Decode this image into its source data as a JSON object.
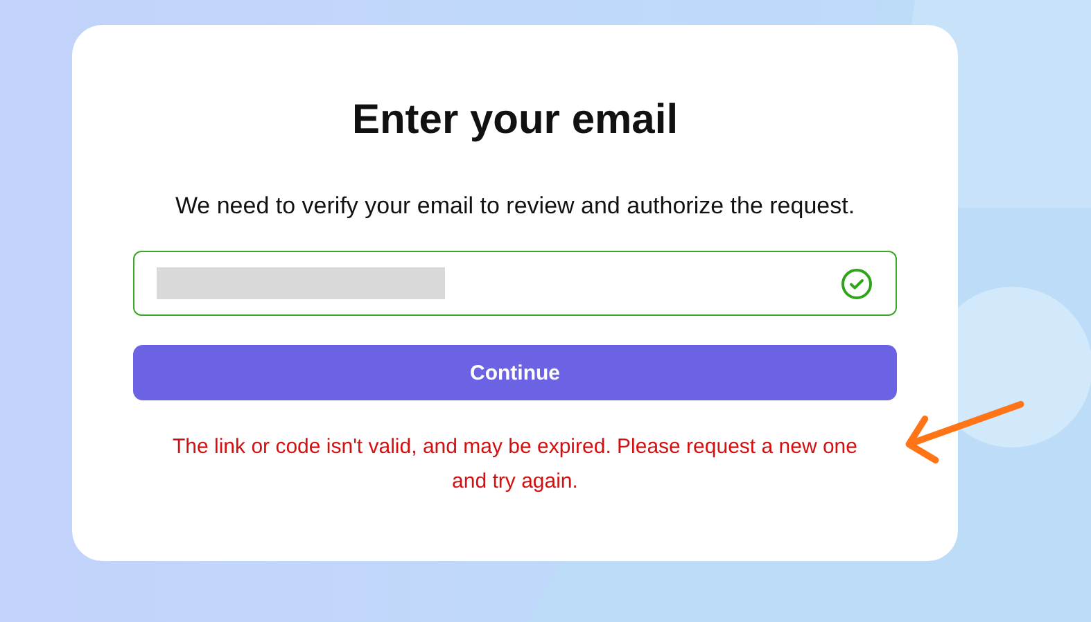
{
  "card": {
    "title": "Enter your email",
    "subtitle": "We need to verify your email to review and authorize the request.",
    "email_field": {
      "valid": true,
      "redacted": true
    },
    "button": "Continue",
    "error": "The link or code isn't valid, and may be expired. Please request a new one and try again."
  },
  "annotation": {
    "kind": "arrow"
  }
}
